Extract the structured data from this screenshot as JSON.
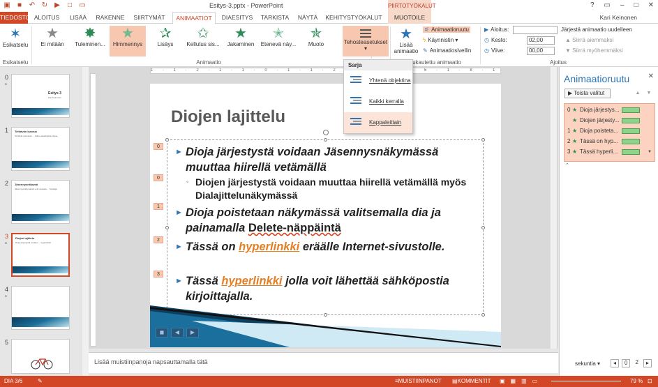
{
  "window": {
    "title": "Esitys-3.pptx - PowerPoint",
    "contextual_group": "PIIRTOTYÖKALUT",
    "user": "Kari Keinonen",
    "controls": [
      "?",
      "▭",
      "–",
      "□",
      "✕"
    ]
  },
  "tabs": [
    "TIEDOSTO",
    "ALOITUS",
    "LISÄÄ",
    "RAKENNE",
    "SIIRTYMÄT",
    "ANIMAATIOT",
    "DIAESITYS",
    "TARKISTA",
    "NÄYTÄ",
    "KEHITYSTYÖKALUT",
    "MUOTOILE"
  ],
  "ribbon": {
    "preview_label": "Esikatselu",
    "preview_group": "Esikatselu",
    "animations": [
      "Ei mitään",
      "Tuleminen...",
      "Himmennys",
      "Lisäys",
      "Kellutus sis...",
      "Jakaminen",
      "Etenevä näy...",
      "Muoto"
    ],
    "animations_group": "Animaatio",
    "effect_options": "Tehosteasetukset",
    "add_animation": "Lisää animaatio",
    "advanced_group": "ukautettu animaatio",
    "animation_pane_btn": "Animaatioruutu",
    "trigger": "Käynnistin",
    "painter": "Animaatiosivellin",
    "start_label": "Aloitus:",
    "start_value": "",
    "duration_label": "Kesto:",
    "duration_value": "02,00",
    "delay_label": "Viive:",
    "delay_value": "00,00",
    "timing_group": "Ajoitus",
    "reorder_title": "Järjestä animaatio uudelleen",
    "move_earlier": "Siirrä aiemmaksi",
    "move_later": "Siirrä myöhemmäksi"
  },
  "dropdown": {
    "header": "Sarja",
    "items": [
      "Yhtenä objektina",
      "Kaikki kerralla",
      "Kappaleittain"
    ],
    "selected": "Kappaleittain"
  },
  "thumbnails": [
    {
      "num": "0",
      "star": "*",
      "title": "Esitys 3",
      "sub": "Kari Keinonen"
    },
    {
      "num": "1",
      "star": "",
      "title": "Tehtävän kuvaus",
      "sub": "Tehtävät annetaan ... Katso asiakirjasta ohjeet"
    },
    {
      "num": "2",
      "star": "",
      "title": "Jäsennysnäkymä",
      "sub": "Jäsennysnäkymässä voit muokata ... Tekstejä"
    },
    {
      "num": "3",
      "star": "*",
      "title": "Diojen lajittelu",
      "sub": "Dioja järjestystä voidaan ... hyperlinkki"
    },
    {
      "num": "4",
      "star": "*",
      "title": "",
      "sub": ""
    },
    {
      "num": "5",
      "star": "",
      "title": "",
      "sub": ""
    }
  ],
  "ruler_text": "1 · 1 · 2 · 1 · 1 · 0 · 1 · 1 · 2 · 1 · 4 · 1 · 6 · 1 · 8 · 1 · 10 · 1 · 12 · 1 · 14 · 1 · 16 · 1 · 18 · 1 · 20 · 1 · 22 · 1 · 23",
  "slide": {
    "title": "Diojen lajittelu",
    "tags": [
      "0",
      "0",
      "1",
      "2",
      "3"
    ],
    "b1": "Dioja järjestystä voidaan Jäsennysnäkymässä muuttaa hiirellä vetämällä",
    "sub1": "Diojen järjestystä voidaan muuttaa hiirellä vetämällä myös Dialajittelunäkymässä",
    "b2_pre": "Dioja poistetaan näkymässä valitsemalla dia ja painamalla ",
    "b2_key": "Delete-näppäintä",
    "b3_pre": "Tässä on ",
    "b3_link": "hyperlinkki",
    "b3_post": " eräälle Internet-sivustolle.",
    "b4_pre": "Tässä ",
    "b4_link": "hyperlinkki",
    "b4_post": " jolla voit lähettää sähköpostia kirjoittajalla."
  },
  "notes_placeholder": "Lisää muistiinpanoja napsauttamalla tätä",
  "pane": {
    "title": "Animaatioruutu",
    "close": "✕",
    "play": "Toista valitut",
    "items": [
      {
        "n": "0",
        "label": "Dioja järjestys..."
      },
      {
        "n": "",
        "label": "Diojen järjesty..."
      },
      {
        "n": "1",
        "label": "Dioja poistetа..."
      },
      {
        "n": "2",
        "label": "Tässä on hyp..."
      },
      {
        "n": "3",
        "label": "Tässä hyperli..."
      }
    ],
    "seconds": "sekuntia",
    "page_from": "0",
    "page_to": "2"
  },
  "status": {
    "slide": "DIA 3/6",
    "notes": "MUISTIINPANOT",
    "comments": "KOMMENTIT",
    "zoom": "79 %"
  }
}
